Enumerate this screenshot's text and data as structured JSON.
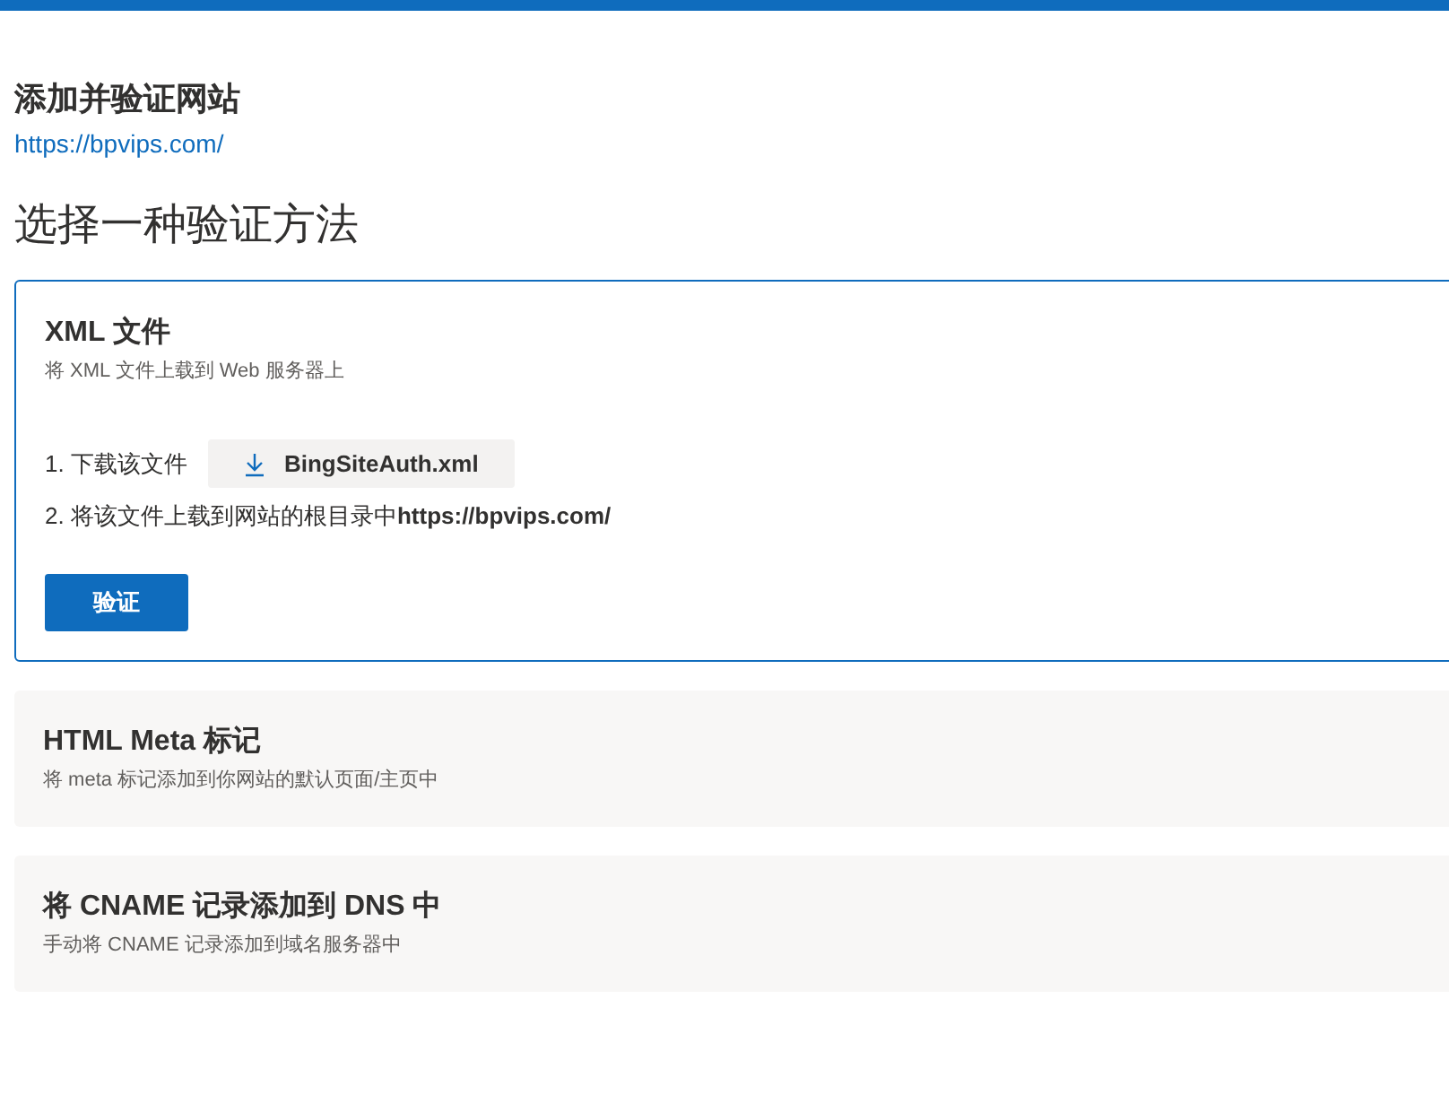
{
  "page": {
    "title": "添加并验证网站",
    "site_url": "https://bpvips.com/"
  },
  "section_title": "选择一种验证方法",
  "methods": [
    {
      "title": "XML 文件",
      "description": "将 XML 文件上载到 Web 服务器上",
      "selected": true,
      "steps": [
        {
          "label": "1. 下载该文件",
          "download": "BingSiteAuth.xml"
        },
        {
          "label": "2. 将该文件上载到网站的根目录中",
          "bold_suffix": "https://bpvips.com/"
        }
      ],
      "action": "验证"
    },
    {
      "title": "HTML Meta 标记",
      "description": "将 meta 标记添加到你网站的默认页面/主页中",
      "selected": false
    },
    {
      "title": "将 CNAME 记录添加到 DNS 中",
      "description": "手动将 CNAME 记录添加到域名服务器中",
      "selected": false
    }
  ]
}
